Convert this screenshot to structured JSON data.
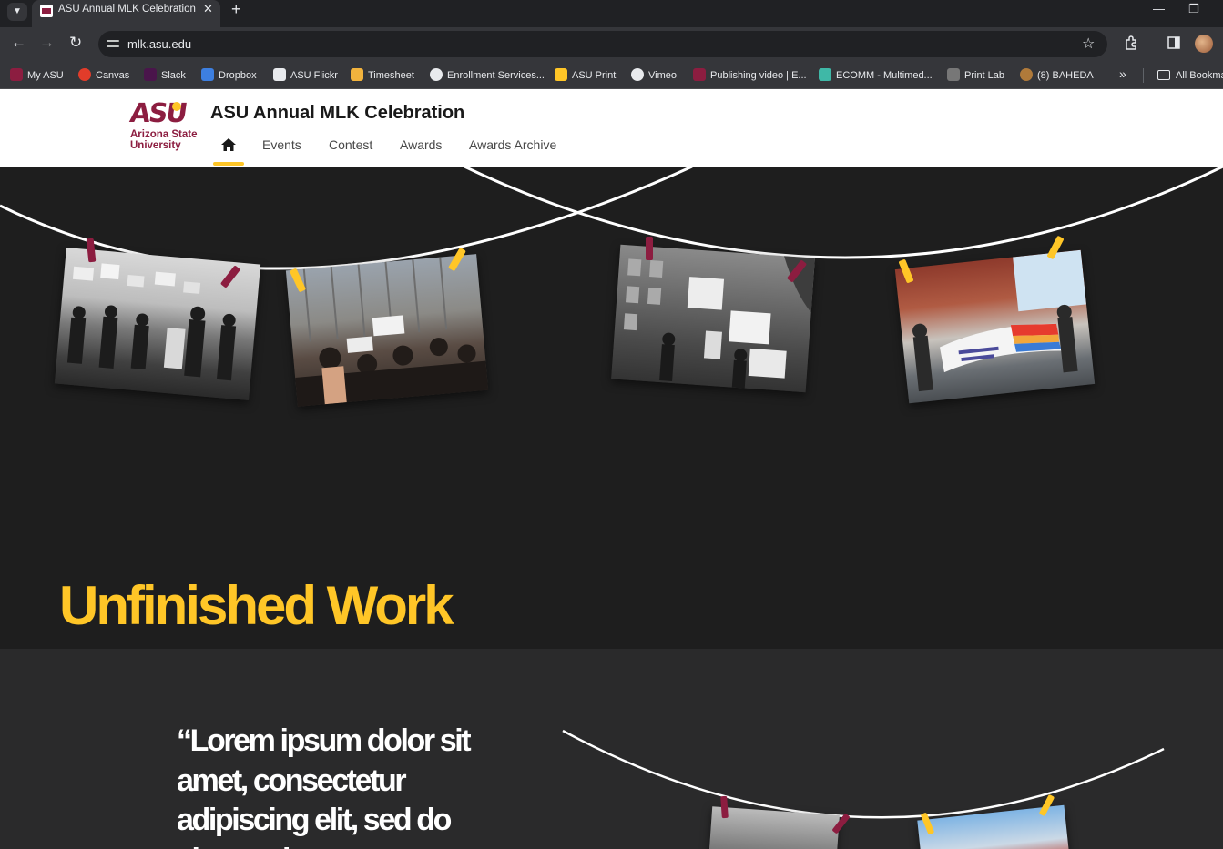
{
  "browser": {
    "tab_title": "ASU Annual MLK Celebration",
    "url": "mlk.asu.edu",
    "bookmarks": [
      {
        "label": "My ASU",
        "color": "#8c1d40"
      },
      {
        "label": "Canvas",
        "color": "#e23c2a"
      },
      {
        "label": "Slack",
        "color": "#4a154b"
      },
      {
        "label": "Dropbox",
        "color": "#3d7fe0"
      },
      {
        "label": "ASU Flickr",
        "color": "#e8eaed"
      },
      {
        "label": "Timesheet",
        "color": "#f2b33d"
      },
      {
        "label": "Enrollment Services...",
        "color": "#e8eaed"
      },
      {
        "label": "ASU Print",
        "color": "#ffc627"
      },
      {
        "label": "Vimeo",
        "color": "#e8eaed"
      },
      {
        "label": "Publishing video | E...",
        "color": "#8c1d40"
      },
      {
        "label": "ECOMM - Multimed...",
        "color": "#3fb8a7"
      },
      {
        "label": "Print Lab",
        "color": "#777777"
      },
      {
        "label": "(8) BAHEDA",
        "color": "#b07a3a"
      }
    ],
    "all_bookmarks": "All Bookmarks"
  },
  "site": {
    "logo_mark": "ASU",
    "logo_name_line1": "Arizona State",
    "logo_name_line2": "University",
    "title": "ASU Annual MLK Celebration",
    "nav": [
      "Events",
      "Contest",
      "Awards",
      "Awards Archive"
    ]
  },
  "hero": {
    "title": "Unfinished Work"
  },
  "quote": {
    "text": "“Lorem ipsum dolor sit amet, consectetur adipiscing elit, sed do eiusmod t"
  },
  "colors": {
    "asu_maroon": "#8c1d40",
    "asu_gold": "#ffc627",
    "hero_bg": "#1e1e1e",
    "quote_bg": "#2a2a2b"
  }
}
